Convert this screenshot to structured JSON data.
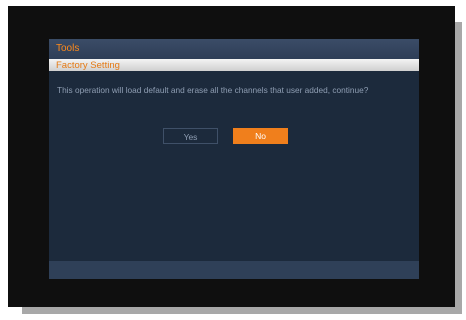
{
  "dialog": {
    "title": "Tools",
    "subtitle": "Factory Setting",
    "message": "This operation will load default and erase all the channels that user added, continue?"
  },
  "buttons": {
    "yes_label": "Yes",
    "no_label": "No",
    "selected": "No"
  },
  "colors": {
    "accent": "#f07f1c",
    "panel_background": "#1c2a3c",
    "header_background": "#33435c",
    "message_text": "#8f9eb3"
  }
}
